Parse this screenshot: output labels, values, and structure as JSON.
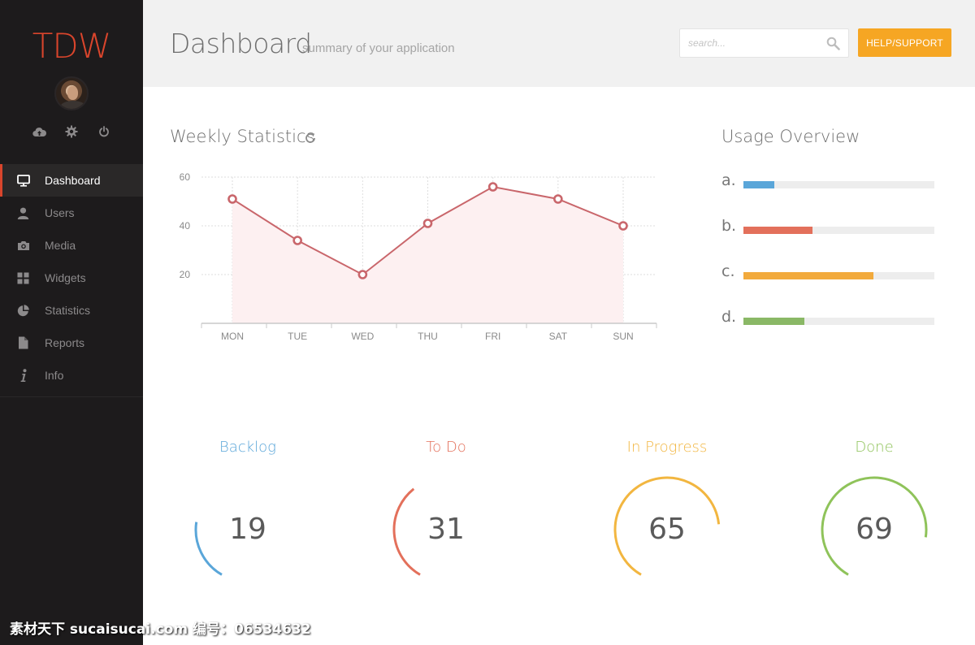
{
  "brand": {
    "logo_text": "TDW"
  },
  "user_actions": [
    {
      "icon": "cloud-upload-icon"
    },
    {
      "icon": "gear-icon"
    },
    {
      "icon": "power-icon"
    }
  ],
  "nav": {
    "items": [
      {
        "label": "Dashboard",
        "icon": "monitor-icon",
        "active": true
      },
      {
        "label": "Users",
        "icon": "user-icon"
      },
      {
        "label": "Media",
        "icon": "camera-icon"
      },
      {
        "label": "Widgets",
        "icon": "grid-icon"
      },
      {
        "label": "Statistics",
        "icon": "pie-chart-icon"
      },
      {
        "label": "Reports",
        "icon": "file-icon"
      },
      {
        "label": "Info",
        "icon": "info-icon"
      }
    ]
  },
  "header": {
    "title": "Dashboard",
    "subtitle": "summary of your application",
    "search_placeholder": "search...",
    "help_label": "HELP/SUPPORT"
  },
  "weekly": {
    "title": "Weekly Statistics"
  },
  "chart_data": {
    "type": "area",
    "categories": [
      "MON",
      "TUE",
      "WED",
      "THU",
      "FRI",
      "SAT",
      "SUN"
    ],
    "values": [
      51,
      34,
      20,
      41,
      56,
      51,
      40
    ],
    "yticks": [
      20,
      40,
      60
    ],
    "ylim": [
      0,
      60
    ],
    "grid": true,
    "color": "#c9666b",
    "fill": "#fdf0f1"
  },
  "usage": {
    "title": "Usage Overview",
    "rows": [
      {
        "label": "a.",
        "fraction": 0.16,
        "color": "#5aa6d9"
      },
      {
        "label": "b.",
        "fraction": 0.36,
        "color": "#e3705b"
      },
      {
        "label": "c.",
        "fraction": 0.68,
        "color": "#f2aa3c"
      },
      {
        "label": "d.",
        "fraction": 0.32,
        "color": "#8ab866"
      }
    ]
  },
  "gauges": [
    {
      "label": "Backlog",
      "value": "19",
      "percent": 19,
      "color": "#5aa6d9"
    },
    {
      "label": "To Do",
      "value": "31",
      "percent": 31,
      "color": "#e3705b"
    },
    {
      "label": "In Progress",
      "value": "65",
      "percent": 65,
      "color": "#f2b640"
    },
    {
      "label": "Done",
      "value": "69",
      "percent": 69,
      "color": "#8fc35a"
    }
  ],
  "watermark": "素材天下 sucaisucai.com  编号：06534632"
}
